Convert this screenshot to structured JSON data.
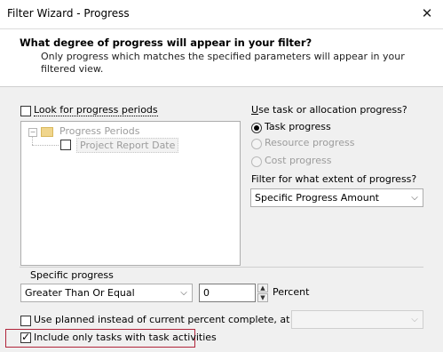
{
  "window": {
    "title": "Filter Wizard - Progress",
    "close_icon": "close-icon"
  },
  "header": {
    "title": "What degree of progress will appear in your filter?",
    "subtitle": "Only progress which matches the specified parameters will appear in your filtered view."
  },
  "periods": {
    "checkbox_label": "Look for progress periods",
    "checked": false,
    "tree": {
      "root_label": "Progress Periods",
      "child_label": "Project Report Date"
    }
  },
  "progress_type": {
    "label": "Use task or allocation progress?",
    "options": [
      {
        "label": "Task progress",
        "selected": true,
        "enabled": true
      },
      {
        "label": "Resource progress",
        "selected": false,
        "enabled": false
      },
      {
        "label": "Cost progress",
        "selected": false,
        "enabled": false
      }
    ]
  },
  "extent": {
    "label": "Filter for what extent of progress?",
    "selected": "Specific Progress Amount"
  },
  "specific_progress": {
    "label": "Specific progress",
    "operator": "Greater Than Or Equal",
    "value": "0",
    "unit": "Percent"
  },
  "planned": {
    "label": "Use planned instead of current percent complete, at date :",
    "checked": false,
    "date_value": ""
  },
  "task_activities": {
    "label": "Include only tasks with task activities",
    "checked": true
  },
  "colors": {
    "highlight": "#b0243a",
    "header_bg": "#ffffff",
    "body_bg": "#f0f0f0"
  }
}
